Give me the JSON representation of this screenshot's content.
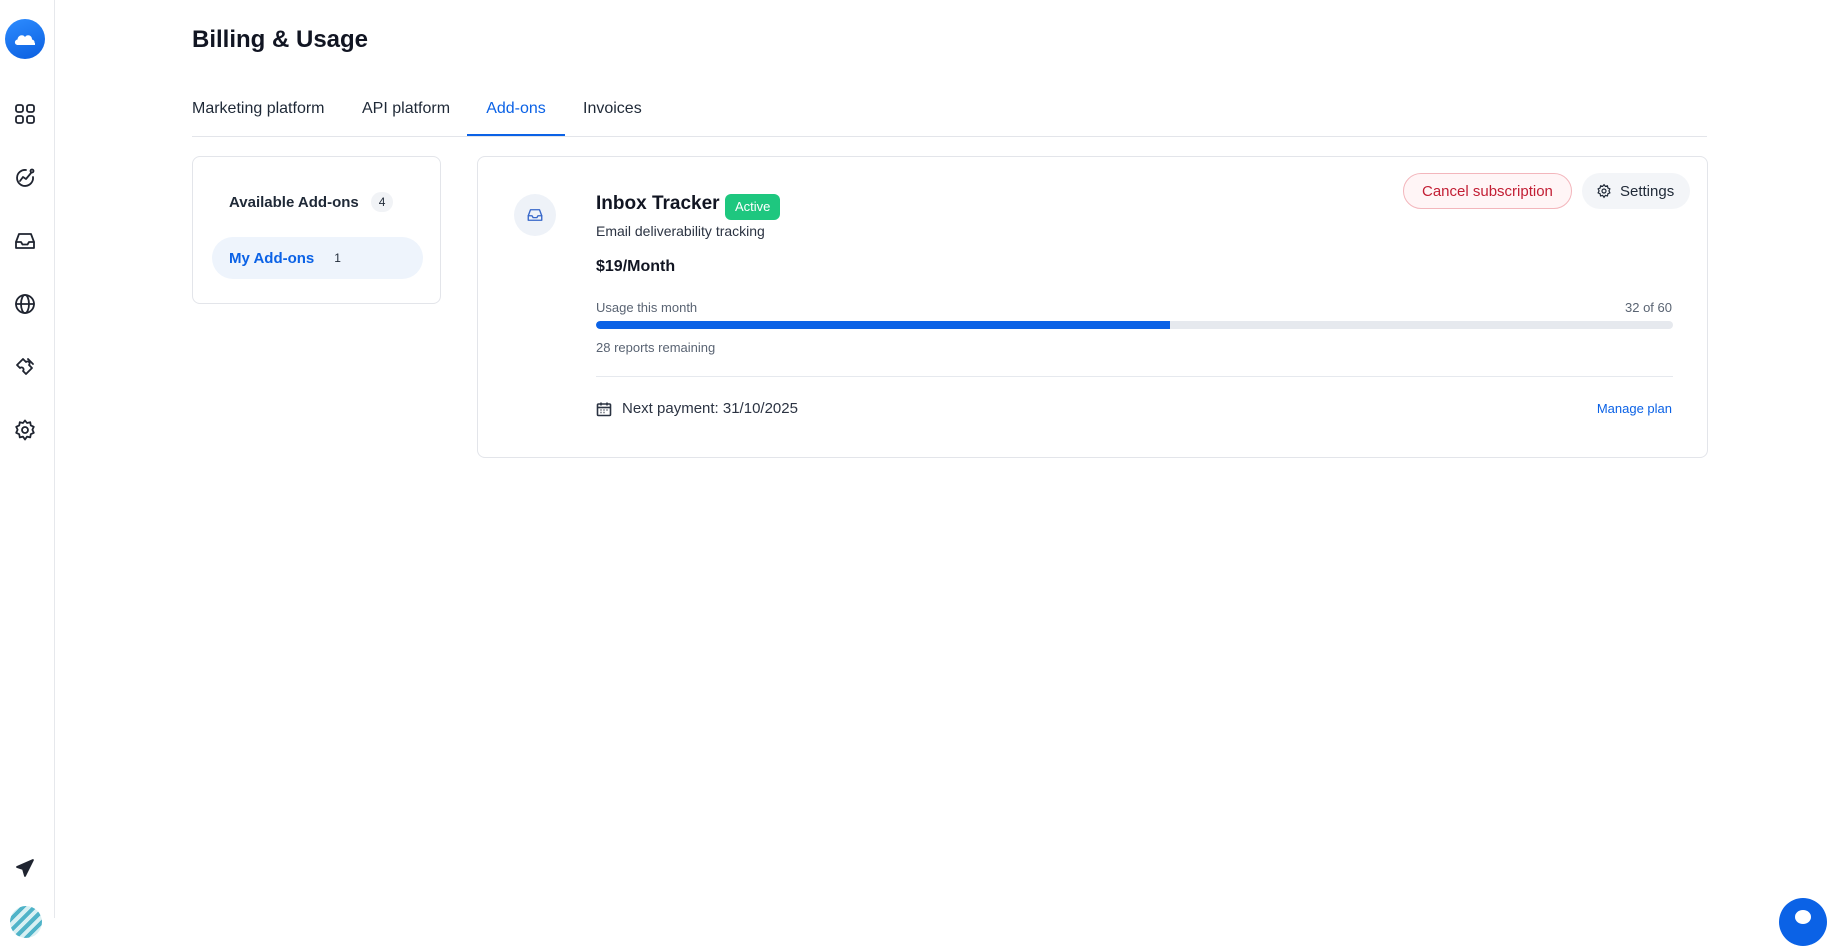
{
  "sidebar": {
    "items": [
      {
        "name": "dashboard",
        "icon": "grid-icon"
      },
      {
        "name": "analytics",
        "icon": "trend-chart-icon"
      },
      {
        "name": "inbox",
        "icon": "inbox-icon"
      },
      {
        "name": "domains",
        "icon": "globe-icon"
      },
      {
        "name": "integrations",
        "icon": "puzzle-icon"
      },
      {
        "name": "settings",
        "icon": "gear-icon"
      }
    ],
    "bottom_items": [
      {
        "name": "send",
        "icon": "paper-plane-icon"
      },
      {
        "name": "profile",
        "icon": "avatar"
      }
    ]
  },
  "page": {
    "title": "Billing & Usage"
  },
  "tabs": [
    {
      "label": "Marketing platform",
      "active": false
    },
    {
      "label": "API platform",
      "active": false
    },
    {
      "label": "Add-ons",
      "active": true
    },
    {
      "label": "Invoices",
      "active": false
    }
  ],
  "addons_menu": [
    {
      "label": "Available Add-ons",
      "count": "4",
      "active": false
    },
    {
      "label": "My Add-ons",
      "count": "1",
      "active": true
    }
  ],
  "addon": {
    "name": "Inbox Tracker",
    "status": "Active",
    "description": "Email deliverability tracking",
    "price": "$19/Month",
    "usage_label": "Usage this month",
    "usage_text": "32 of 60",
    "usage_used": 32,
    "usage_total": 60,
    "remaining_text": "28 reports remaining",
    "next_payment": "Next payment: 31/10/2025",
    "manage_label": "Manage plan",
    "cancel_label": "Cancel subscription",
    "settings_label": "Settings"
  },
  "colors": {
    "accent": "#0b62e6",
    "status_active": "#1ec77f",
    "danger": "#c21e34"
  }
}
